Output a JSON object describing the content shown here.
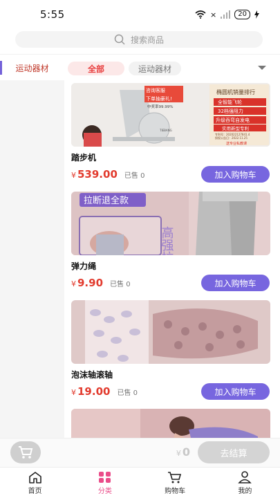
{
  "status": {
    "time": "5:55",
    "signal": "×",
    "battery": "20"
  },
  "search": {
    "placeholder": "搜索商品"
  },
  "sidebar": {
    "items": [
      {
        "label": "运动器材"
      }
    ]
  },
  "filters": {
    "chips": [
      {
        "label": "全部"
      },
      {
        "label": "运动器材"
      }
    ]
  },
  "products": [
    {
      "name": "踏步机",
      "currency": "¥",
      "price": "539.00",
      "sold": "已售 0",
      "button": "加入购物车",
      "image_text": {
        "service": "咨询客服",
        "gift": "下单抽豪礼!",
        "win": "中奖率99.99%",
        "rank": "椭圆机销量排行",
        "feature1": "全智能飞轮",
        "feature2": "32档强阻力",
        "feature3": "升级吞弯自发电",
        "patent": "实用新型专利",
        "patent_no1": "专利号：202022127841.4",
        "patent_no2": "授权公告日：2022.11.25",
        "gift2": "送专业私教课",
        "brand": "TIEBANG"
      }
    },
    {
      "name": "弹力绳",
      "currency": "¥",
      "price": "9.90",
      "sold": "已售 0",
      "button": "加入购物车",
      "image_text": {
        "tag": "拉断退全款",
        "slogan": "高强拉"
      }
    },
    {
      "name": "泡沫轴滚轴",
      "currency": "¥",
      "price": "19.00",
      "sold": "已售 0",
      "button": "加入购物车",
      "image_text": {}
    },
    {
      "name": "",
      "currency": "",
      "price": "",
      "sold": "",
      "button": "",
      "image_text": {}
    }
  ],
  "cart": {
    "currency": "¥",
    "total": "0",
    "checkout": "去结算"
  },
  "tabs": [
    {
      "label": "首页",
      "icon": "home-icon"
    },
    {
      "label": "分类",
      "icon": "category-icon"
    },
    {
      "label": "购物车",
      "icon": "cart-icon"
    },
    {
      "label": "我的",
      "icon": "user-icon"
    }
  ],
  "colors": {
    "accent": "#7766df",
    "price": "#e23b2e",
    "active_tab": "#ea4c89"
  }
}
